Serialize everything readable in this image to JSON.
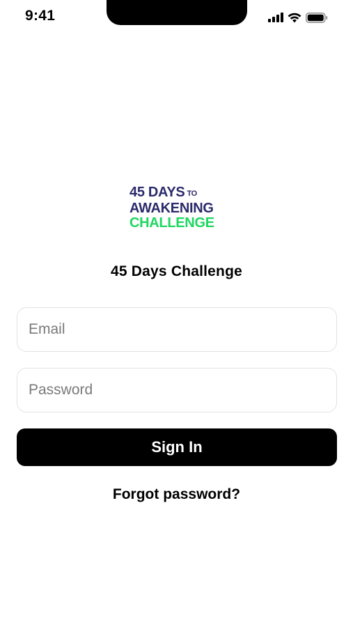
{
  "status_bar": {
    "time": "9:41",
    "icons": [
      "cellular-signal-icon",
      "wifi-icon",
      "battery-icon"
    ]
  },
  "logo": {
    "line1": "45 DAYS",
    "line1_small": "TO",
    "line2": "AWAKENING",
    "line3": "CHALLENGE",
    "colors": {
      "navy": "#2b2a6b",
      "green": "#1ed760"
    }
  },
  "title": "45 Days Challenge",
  "form": {
    "email_placeholder": "Email",
    "email_value": "",
    "password_placeholder": "Password",
    "password_value": "",
    "sign_in_label": "Sign In",
    "forgot_password_label": "Forgot password?"
  },
  "colors": {
    "background": "#ffffff",
    "primary_button": "#000000",
    "primary_button_text": "#ffffff",
    "field_border": "#e2e2e2",
    "placeholder": "#7a7a7a"
  }
}
